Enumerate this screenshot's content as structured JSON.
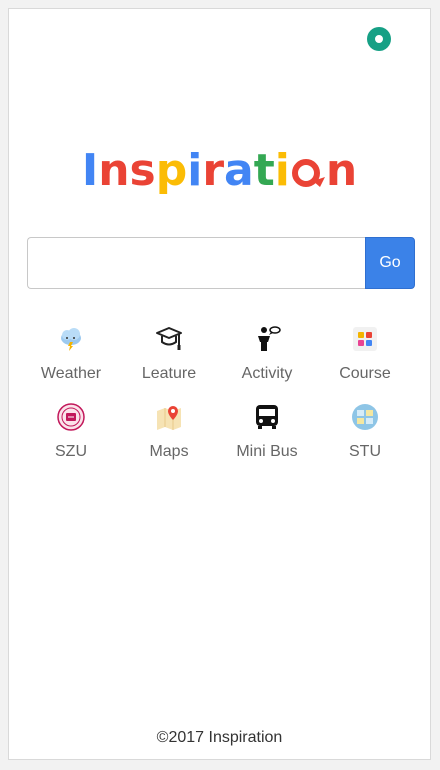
{
  "header": {
    "status_icon": "record-icon",
    "status_color": "#16a085"
  },
  "logo": {
    "letters": [
      "I",
      "n",
      "s",
      "p",
      "i",
      "r",
      "a",
      "t",
      "i",
      "o",
      "n"
    ],
    "colors": [
      "#4285f4",
      "#ea4335",
      "#fbbc05",
      "#34a853"
    ]
  },
  "search": {
    "value": "",
    "placeholder": "",
    "go_label": "Go"
  },
  "apps": [
    {
      "label": "Weather",
      "icon": "weather-cloud-icon"
    },
    {
      "label": "Leature",
      "icon": "graduation-cap-icon"
    },
    {
      "label": "Activity",
      "icon": "speaker-podium-icon"
    },
    {
      "label": "Course",
      "icon": "course-grid-icon"
    },
    {
      "label": "SZU",
      "icon": "szu-emblem-icon"
    },
    {
      "label": "Maps",
      "icon": "map-pin-icon"
    },
    {
      "label": "Mini Bus",
      "icon": "bus-icon"
    },
    {
      "label": "STU",
      "icon": "stu-emblem-icon"
    }
  ],
  "footer": {
    "copyright": "©2017 Inspiration"
  }
}
